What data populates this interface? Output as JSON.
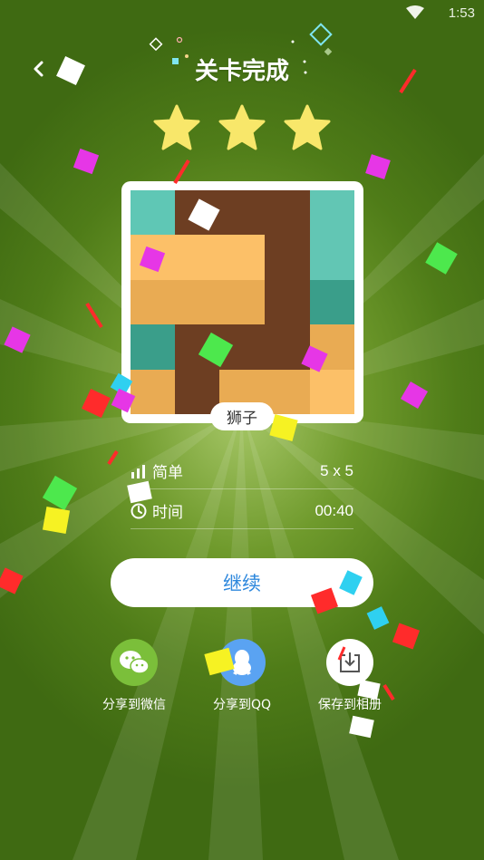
{
  "status": {
    "time": "1:53"
  },
  "header": {
    "title": "关卡完成"
  },
  "rating": {
    "stars": 3,
    "max": 3
  },
  "puzzle": {
    "name": "狮子"
  },
  "stats": {
    "difficulty_label": "简单",
    "difficulty_value": "5 x 5",
    "time_label": "时间",
    "time_value": "00:40"
  },
  "actions": {
    "continue_label": "继续",
    "share_wechat_label": "分享到微信",
    "share_qq_label": "分享到QQ",
    "save_album_label": "保存到相册"
  },
  "colors": {
    "accent": "#2e88dd",
    "wechat": "#7bbf3a",
    "qq": "#5aa3f2",
    "star": "#f8e76a"
  },
  "icons": [
    "wifi-icon",
    "back-arrow-icon",
    "star-icon",
    "bar-chart-icon",
    "clock-icon",
    "wechat-icon",
    "qq-icon",
    "download-icon"
  ]
}
